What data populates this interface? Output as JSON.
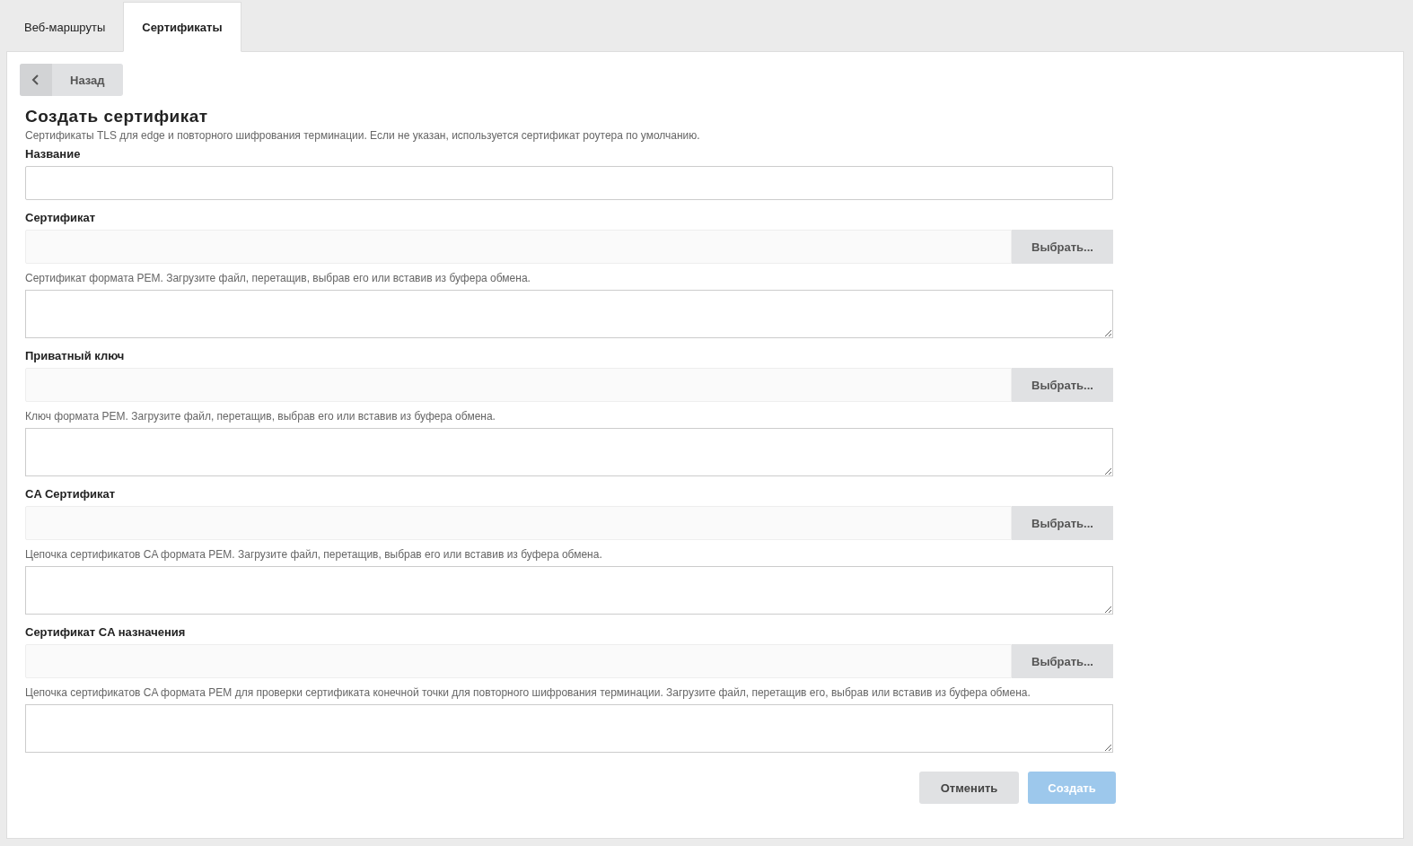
{
  "tabs": [
    {
      "label": "Веб-маршруты",
      "selected": false
    },
    {
      "label": "Сертификаты",
      "selected": true
    }
  ],
  "back_button": {
    "label": "Назад"
  },
  "title": "Создать сертификат",
  "description": "Сертификаты TLS для edge и повторного шифрования терминации. Если не указан, используется сертификат роутера по умолчанию.",
  "fields": [
    {
      "kind": "text",
      "label": "Название"
    },
    {
      "kind": "file",
      "label": "Сертификат",
      "button": "Выбрать...",
      "help": "Сертификат формата PEM. Загрузите файл, перетащив, выбрав его или вставив из буфера обмена."
    },
    {
      "kind": "file",
      "label": "Приватный ключ",
      "button": "Выбрать...",
      "help": "Ключ формата PEM. Загрузите файл, перетащив, выбрав его или вставив из буфера обмена."
    },
    {
      "kind": "file",
      "label": "CA Сертификат",
      "button": "Выбрать...",
      "help": "Цепочка сертификатов CA формата PEM. Загрузите файл, перетащив, выбрав его или вставив из буфера обмена."
    },
    {
      "kind": "file",
      "label": "Сертификат CA назначения",
      "button": "Выбрать...",
      "help": "Цепочка сертификатов CA формата PEM для проверки сертификата конечной точки для повторного шифрования терминации. Загрузите файл, перетащив его, выбрав или вставив из буфера обмена."
    }
  ],
  "buttons": [
    {
      "kind": "secondary",
      "label": "Отменить",
      "disabled": false
    },
    {
      "kind": "primary",
      "label": "Создать",
      "disabled": true
    }
  ]
}
